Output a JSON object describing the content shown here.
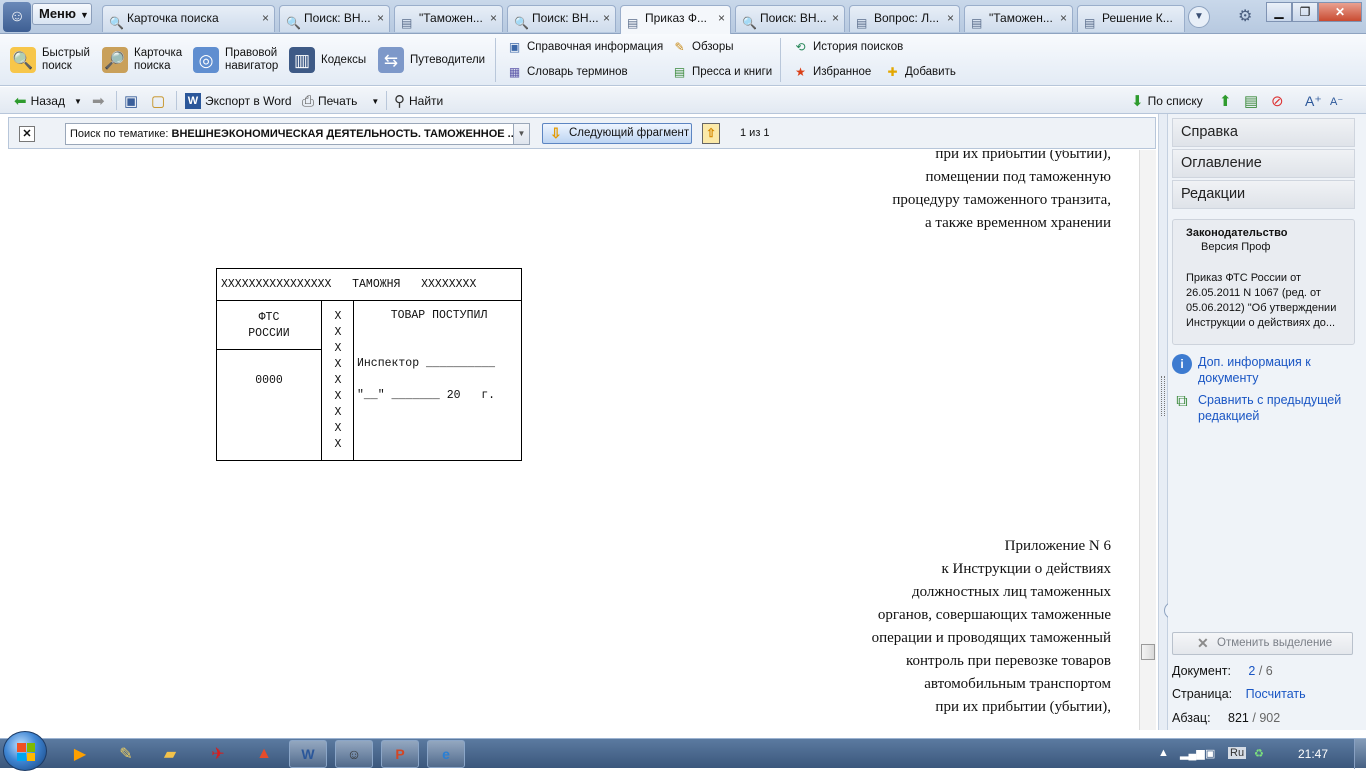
{
  "menu": {
    "label": "Меню"
  },
  "tabs": [
    {
      "label": "Карточка поиска",
      "icon": "search-card-icon"
    },
    {
      "label": "Поиск: ВН...",
      "icon": "search-icon"
    },
    {
      "label": "\"Таможен...",
      "icon": "document-icon"
    },
    {
      "label": "Поиск: ВН...",
      "icon": "search-icon"
    },
    {
      "label": "Приказ Ф...",
      "icon": "document-icon",
      "active": true
    },
    {
      "label": "Поиск: ВН...",
      "icon": "search-icon"
    },
    {
      "label": "Вопрос: Л...",
      "icon": "document-icon"
    },
    {
      "label": "\"Таможен...",
      "icon": "document-icon"
    },
    {
      "label": "Решение К...",
      "icon": "document-icon"
    }
  ],
  "toolbar": {
    "quick_search": "Быстрый поиск",
    "search_card": "Карточка поиска",
    "legal_navigator": "Правовой навигатор",
    "codes": "Кодексы",
    "guides": "Путеводители",
    "reference_info": "Справочная информация",
    "reviews": "Обзоры",
    "dictionary": "Словарь терминов",
    "press_books": "Пресса и книги",
    "search_history": "История поисков",
    "favorites": "Избранное",
    "add": "Добавить"
  },
  "toolbar2": {
    "back": "Назад",
    "export_word": "Экспорт в Word",
    "print": "Печать",
    "find": "Найти",
    "by_list": "По списку"
  },
  "searchbar": {
    "query_prefix": "Поиск по тематике: ",
    "query_value": "ВНЕШНЕЭКОНОМИЧЕСКАЯ ДЕЯТЕЛЬНОСТЬ. ТАМОЖЕННОЕ ...",
    "next_fragment": "Следующий фрагмент",
    "count": "1 из 1"
  },
  "document": {
    "top_lines": [
      "при их прибытии (убытии),",
      "помещении под таможенную",
      "процедуру таможенного транзита,",
      "а также временном хранении"
    ],
    "form": {
      "header": "XXXXXXXXXXXXXXXX   ТАМОЖНЯ   XXXXXXXX",
      "fts": "ФТС\nРОССИИ",
      "code": "0000",
      "x_column": "X\nX\nX\nX\nX\nX\nX\nX\nX",
      "goods": "ТОВАР ПОСТУПИЛ",
      "inspector": "Инспектор __________",
      "date": "\"__\" _______ 20   г."
    },
    "appendix_lines": [
      "Приложение N 6",
      "к Инструкции о действиях",
      "должностных лиц таможенных",
      "органов, совершающих таможенные",
      "операции и проводящих таможенный",
      "контроль при перевозке товаров",
      "автомобильным транспортом",
      "при их прибытии (убытии),"
    ]
  },
  "right_panel": {
    "help": "Справка",
    "contents": "Оглавление",
    "editions": "Редакции",
    "card_title": "Законодательство",
    "card_subtitle": "Версия Проф",
    "card_desc": "Приказ ФТС России от 26.05.2011 N 1067 (ред. от 05.06.2012) \"Об утверждении Инструкции о действиях до...",
    "more_info": "Доп. информация к документу",
    "compare": "Сравнить с предыдущей редакцией",
    "reset_selection": "Отменить выделение",
    "doc_label": "Документ:",
    "doc_current": "2",
    "doc_total": "/ 6",
    "page_label": "Страница:",
    "page_value": "Посчитать",
    "para_label": "Абзац:",
    "para_current": "821",
    "para_total": "/ 902"
  },
  "taskbar": {
    "lang": "Ru",
    "time": "21:47"
  }
}
